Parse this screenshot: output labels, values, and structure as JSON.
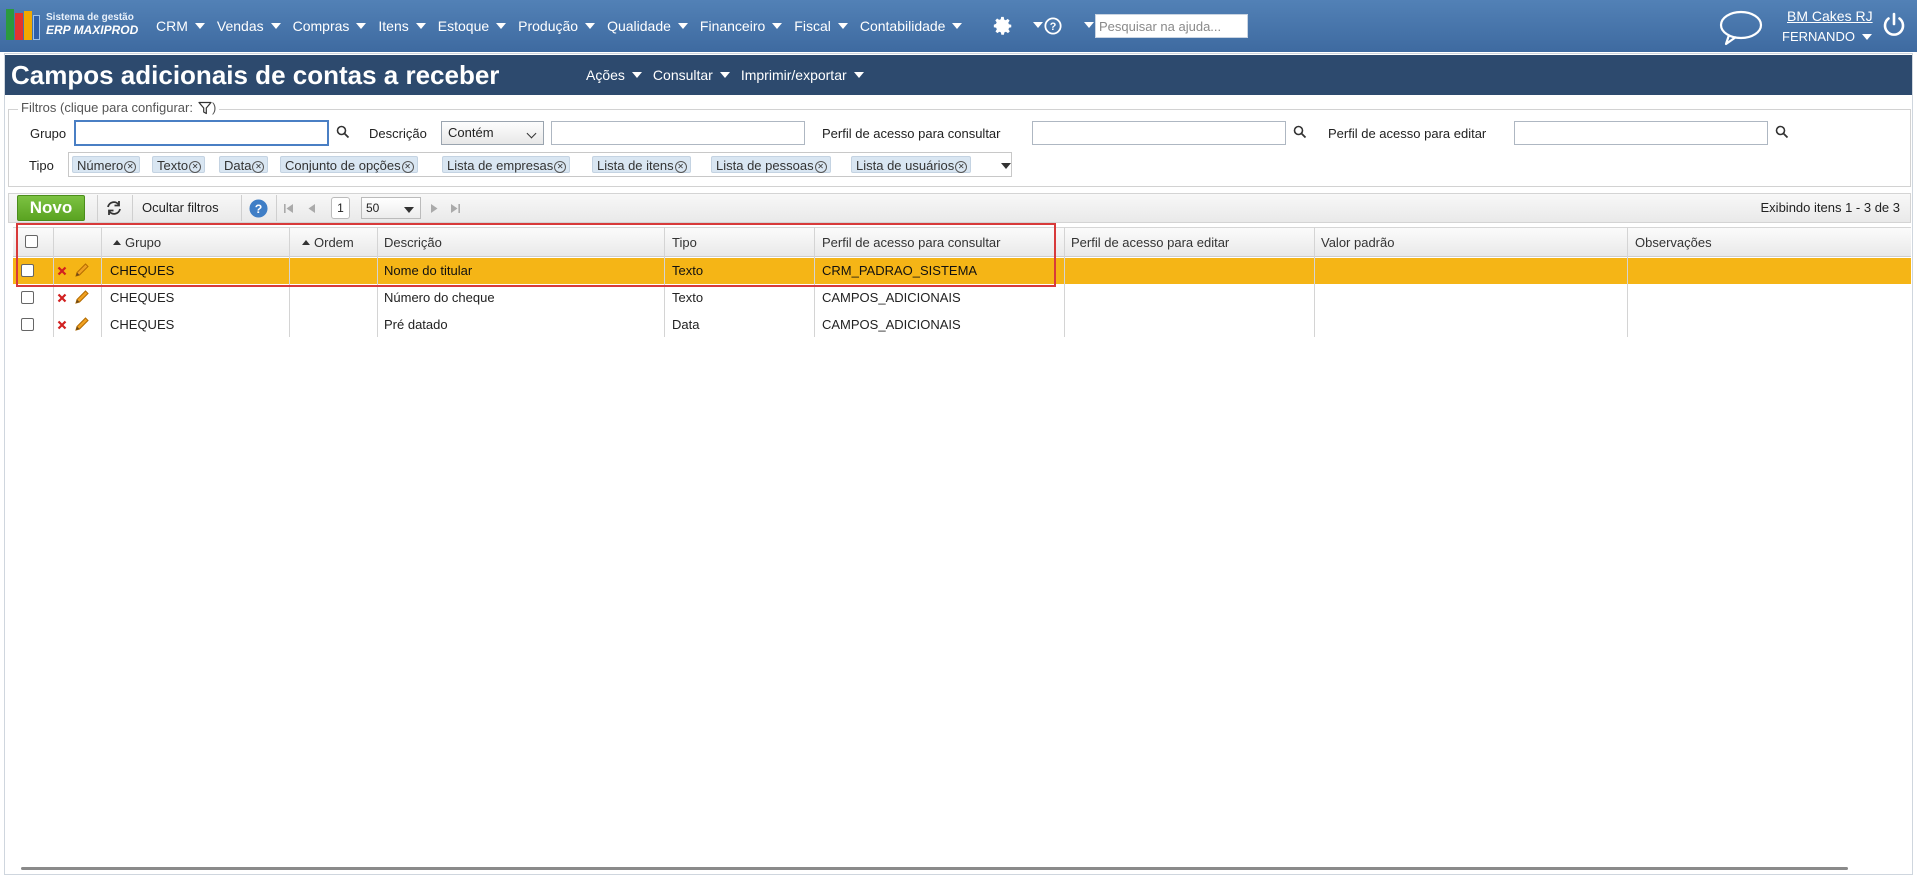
{
  "app": {
    "logo_line1": "Sistema de gestão",
    "logo_line2": "ERP MAXIPROD",
    "brand_colors": [
      "#2b9a3e",
      "#e3342f",
      "#f2a900",
      "#2f5fa8"
    ]
  },
  "topnav": {
    "items": [
      {
        "label": "CRM"
      },
      {
        "label": "Vendas"
      },
      {
        "label": "Compras"
      },
      {
        "label": "Itens"
      },
      {
        "label": "Estoque"
      },
      {
        "label": "Produção"
      },
      {
        "label": "Qualidade"
      },
      {
        "label": "Financeiro"
      },
      {
        "label": "Fiscal"
      },
      {
        "label": "Contabilidade"
      }
    ],
    "settings_icon": "gear-icon",
    "help_icon": "question-circle-icon",
    "search_placeholder": "Pesquisar na ajuda...",
    "company": "BM Cakes RJ",
    "user": "FERNANDO",
    "bar_color": "#4472a8"
  },
  "page": {
    "title": "Campos adicionais de contas a receber",
    "menu": [
      {
        "label": "Ações"
      },
      {
        "label": "Consultar"
      },
      {
        "label": "Imprimir/exportar"
      }
    ]
  },
  "filters": {
    "legend": "Filtros (clique para configurar:",
    "legend_end": ")",
    "grupo_label": "Grupo",
    "grupo_value": "",
    "descricao_label": "Descrição",
    "descricao_operator": "Contém",
    "descricao_value": "",
    "perfil_consultar_label": "Perfil de acesso para consultar",
    "perfil_consultar_value": "",
    "perfil_editar_label": "Perfil de acesso para editar",
    "perfil_editar_value": "",
    "tipo_label": "Tipo",
    "tipo_tags": [
      "Número",
      "Texto",
      "Data",
      "Conjunto de opções",
      "Lista de empresas",
      "Lista de itens",
      "Lista de pessoas",
      "Lista de usuários"
    ]
  },
  "toolbar": {
    "new_label": "Novo",
    "hide_filters_label": "Ocultar filtros",
    "current_page": "1",
    "page_size": "50",
    "items_info": "Exibindo itens 1 - 3 de 3"
  },
  "grid": {
    "columns": {
      "grupo": "Grupo",
      "ordem": "Ordem",
      "descricao": "Descrição",
      "tipo": "Tipo",
      "perfil_consultar": "Perfil de acesso para consultar",
      "perfil_editar": "Perfil de acesso para editar",
      "valor_padrao": "Valor padrão",
      "observacoes": "Observações"
    },
    "rows": [
      {
        "grupo": "CHEQUES",
        "ordem": "",
        "descricao": "Nome do titular",
        "tipo": "Texto",
        "perfil_consultar": "CRM_PADRAO_SISTEMA",
        "perfil_editar": "",
        "valor_padrao": "",
        "observacoes": "",
        "selected": true
      },
      {
        "grupo": "CHEQUES",
        "ordem": "",
        "descricao": "Número do cheque",
        "tipo": "Texto",
        "perfil_consultar": "CAMPOS_ADICIONAIS",
        "perfil_editar": "",
        "valor_padrao": "",
        "observacoes": "",
        "selected": false
      },
      {
        "grupo": "CHEQUES",
        "ordem": "",
        "descricao": "Pré datado",
        "tipo": "Data",
        "perfil_consultar": "CAMPOS_ADICIONAIS",
        "perfil_editar": "",
        "valor_padrao": "",
        "observacoes": "",
        "selected": false
      }
    ],
    "selected_row_color": "#f5b516",
    "highlight_color": "#d83a3a"
  }
}
